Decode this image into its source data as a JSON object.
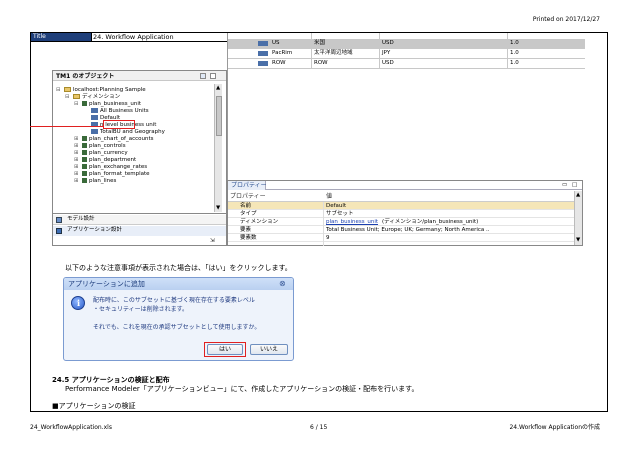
{
  "header": {
    "printed_on": "Printed on 2017/12/27"
  },
  "sheet": {
    "title_label": "Title",
    "title_text": "24. Workflow Application"
  },
  "top_grid": {
    "rows": [
      {
        "name": "US",
        "jp": "米国",
        "currency": "USD",
        "value": "1.0"
      },
      {
        "name": "PacRim",
        "jp": "太平洋周辺地域",
        "currency": "JPY",
        "value": "1.0"
      },
      {
        "name": "ROW",
        "jp": "ROW",
        "currency": "USD",
        "value": "1.0"
      }
    ]
  },
  "objects_panel": {
    "title": "TM1 のオブジェクト",
    "tree": [
      {
        "label": "localhost:Planning Sample",
        "level": 0,
        "expander": "⊟"
      },
      {
        "label": "ディメンション",
        "level": 1,
        "expander": "⊟"
      },
      {
        "label": "plan_business_unit",
        "level": 2,
        "expander": "⊟"
      },
      {
        "label": "All Business Units",
        "level": 3,
        "expander": ""
      },
      {
        "label": "Default",
        "level": 3,
        "expander": ""
      },
      {
        "label": "n level business unit",
        "level": 3,
        "expander": ""
      },
      {
        "label": "TotalBU and Geography",
        "level": 3,
        "expander": ""
      },
      {
        "label": "plan_chart_of_accounts",
        "level": 2,
        "expander": "⊞"
      },
      {
        "label": "plan_controls",
        "level": 2,
        "expander": "⊞"
      },
      {
        "label": "plan_currency",
        "level": 2,
        "expander": "⊞"
      },
      {
        "label": "plan_department",
        "level": 2,
        "expander": "⊞"
      },
      {
        "label": "plan_exchange_rates",
        "level": 2,
        "expander": "⊞"
      },
      {
        "label": "plan_format_template",
        "level": 2,
        "expander": "⊞"
      },
      {
        "label": "plan_lines",
        "level": 2,
        "expander": "⊞"
      }
    ],
    "tab_model": "モデル設計",
    "tab_app": "アプリケーション設計"
  },
  "properties": {
    "tab": "プロパティー",
    "col_property": "プロパティー",
    "col_value": "値",
    "rows": [
      {
        "key": "名前",
        "val": "Default",
        "link": false
      },
      {
        "key": "タイプ",
        "val": "サブセット",
        "link": false
      },
      {
        "key": "ディメンション",
        "val": "plan_business_unit",
        "val2": "(ディメンション/plan_business_unit)",
        "link": true
      },
      {
        "key": "要素",
        "val": "Total Business Unit; Europe; UK; Germany; North America ..",
        "link": false
      },
      {
        "key": "要素数",
        "val": "9",
        "link": false
      }
    ]
  },
  "body": {
    "instruction": "以下のような注意事項が表示された場合は、「はい」をクリックします。",
    "section_heading": "24.5 アプリケーションの検証と配布",
    "section_text": "Performance Modeler「アプリケーションビュー」にて、作成したアプリケーションの検証・配布を行います。",
    "subheading": "■アプリケーションの検証"
  },
  "dialog": {
    "title": "アプリケーションに追加",
    "close": "⊗",
    "line1": "配布時に、このサブセットに基づく現在存在する要素レベル",
    "line2": "・セキュリティーは削除されます。",
    "line3": "それでも、これを現在の承認サブセットとして使用しますか。",
    "yes": "はい",
    "no": "いいえ"
  },
  "footer": {
    "file": "24_WorkflowApplication.xls",
    "page": "6 / 15",
    "right": "24.Workflow Applicationの作成"
  },
  "colors": {
    "title_bg": "#1f3f7a",
    "highlight": "#e02020",
    "selected_row": "#f5e6b8"
  }
}
